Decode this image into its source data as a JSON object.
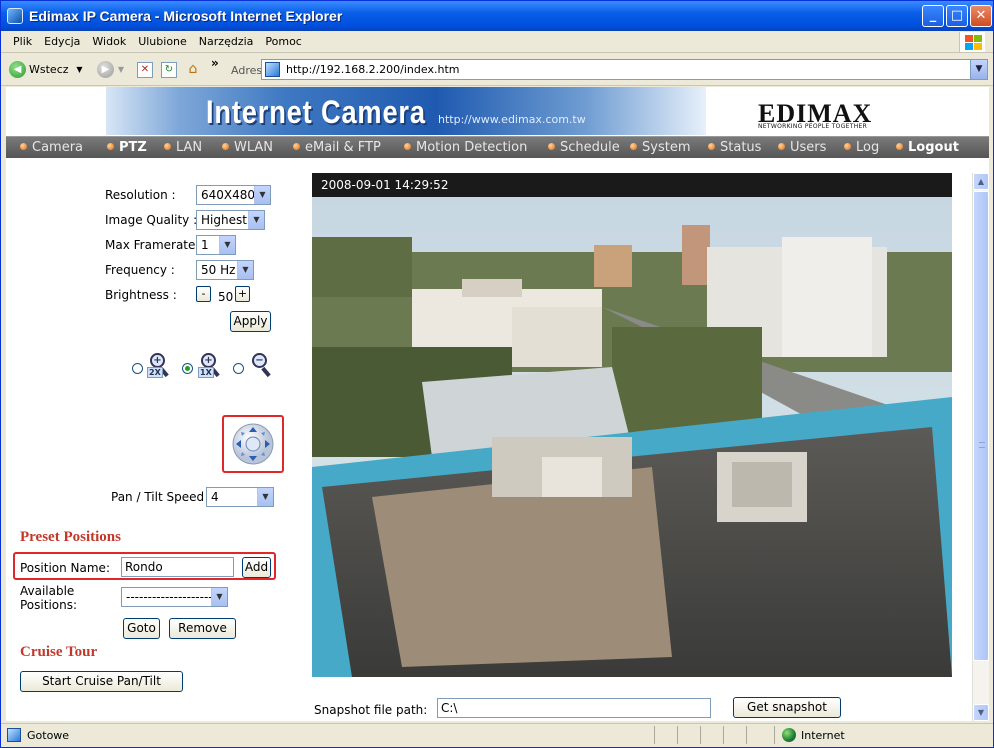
{
  "window": {
    "title": "Edimax IP Camera - Microsoft Internet Explorer",
    "controls": {
      "minimize": "_",
      "maximize": "□",
      "close": "✕"
    }
  },
  "menu": [
    "Plik",
    "Edycja",
    "Widok",
    "Ulubione",
    "Narzędzia",
    "Pomoc"
  ],
  "toolbar": {
    "back_label": "Wstecz",
    "chevron": "»",
    "address_label": "Adres",
    "url": "http://192.168.2.200/index.htm"
  },
  "banner": {
    "title": "Internet Camera",
    "url": "http://www.edimax.com.tw",
    "logo": "EDIMAX",
    "logo_tagline": "NETWORKING PEOPLE TOGETHER"
  },
  "nav": [
    {
      "label": "Camera",
      "bold": false
    },
    {
      "label": "PTZ",
      "bold": true
    },
    {
      "label": "LAN",
      "bold": false
    },
    {
      "label": "WLAN",
      "bold": false
    },
    {
      "label": "eMail & FTP",
      "bold": false
    },
    {
      "label": "Motion Detection",
      "bold": false
    },
    {
      "label": "Schedule",
      "bold": false
    },
    {
      "label": "System",
      "bold": false
    },
    {
      "label": "Status",
      "bold": false
    },
    {
      "label": "Users",
      "bold": false
    },
    {
      "label": "Log",
      "bold": false
    },
    {
      "label": "Logout",
      "bold": true
    }
  ],
  "settings": {
    "resolution": {
      "label": "Resolution :",
      "value": "640X480"
    },
    "image_quality": {
      "label": "Image Quality :",
      "value": "Highest"
    },
    "max_framerate": {
      "label": "Max Framerate :",
      "value": "1"
    },
    "frequency": {
      "label": "Frequency :",
      "value": "50 Hz"
    },
    "brightness": {
      "label": "Brightness :",
      "value": "50",
      "minus": "-",
      "plus": "+"
    },
    "apply": "Apply"
  },
  "zoom": {
    "options": [
      "2X",
      "1X",
      ""
    ],
    "selected": 1
  },
  "ptz": {
    "speed_label": "Pan / Tilt Speed :",
    "speed_value": "4"
  },
  "preset": {
    "title": "Preset Positions",
    "name_label": "Position Name:",
    "name_value": "Rondo",
    "add": "Add",
    "available_label": "Available\nPositions:",
    "available_value": "--------------------",
    "goto": "Goto",
    "remove": "Remove"
  },
  "cruise": {
    "title": "Cruise Tour",
    "start": "Start Cruise Pan/Tilt"
  },
  "camera": {
    "timestamp": "2008-09-01 14:29:52"
  },
  "snapshot": {
    "label": "Snapshot file path:",
    "path": "C:\\",
    "button": "Get snapshot"
  },
  "statusbar": {
    "text": "Gotowe",
    "zone": "Internet"
  }
}
